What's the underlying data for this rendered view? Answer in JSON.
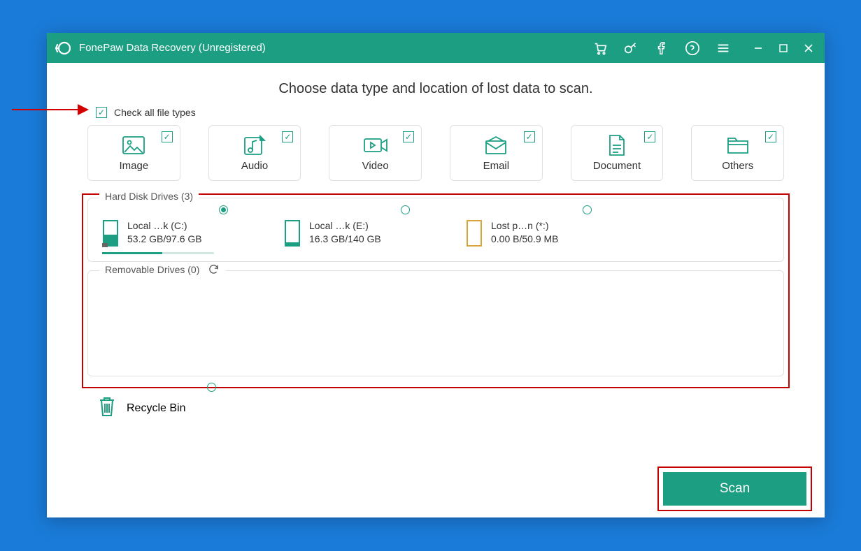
{
  "title": "FonePaw Data Recovery (Unregistered)",
  "heading": "Choose data type and location of lost data to scan.",
  "check_all_label": "Check all file types",
  "types": {
    "image": "Image",
    "audio": "Audio",
    "video": "Video",
    "email": "Email",
    "document": "Document",
    "others": "Others"
  },
  "hard_disk_legend": "Hard Disk Drives (3)",
  "removable_legend": "Removable Drives (0)",
  "drives": [
    {
      "name": "Local …k (C:)",
      "size": "53.2 GB/97.6 GB",
      "used_pct": 54,
      "selected": true,
      "color": "#1b9e82"
    },
    {
      "name": "Local …k (E:)",
      "size": "16.3 GB/140 GB",
      "used_pct": 12,
      "selected": false,
      "color": "#1b9e82"
    },
    {
      "name": "Lost p…n (*:)",
      "size": "0.00  B/50.9 MB",
      "used_pct": 0,
      "selected": false,
      "color": "#d8a43a"
    }
  ],
  "recycle_bin_label": "Recycle Bin",
  "scan_label": "Scan"
}
